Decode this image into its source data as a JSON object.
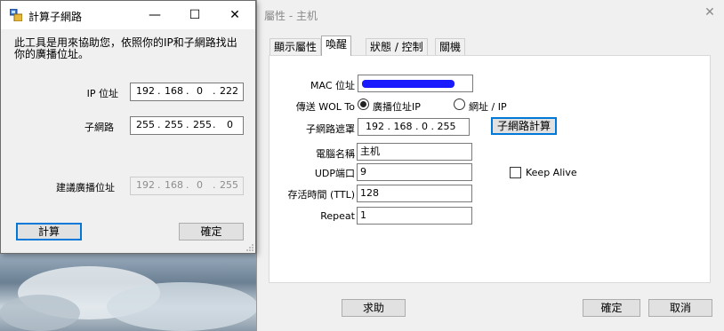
{
  "main_window": {
    "title": "屬性 - 主机",
    "tabs": [
      "顯示屬性",
      "喚醒",
      "狀態 / 控制",
      "關機"
    ],
    "active_tab": "喚醒",
    "form": {
      "mac_label": "MAC 位址",
      "wol_label": "傳送 WOL To",
      "radio_broadcast": "廣播位址IP",
      "radio_url": "網址 / IP",
      "subnet_mask_label": "子網路遮罩",
      "subnet_mask_value": "192 . 168 . 0 . 255",
      "subnet_calc_button": "子網路計算",
      "computer_name_label": "電腦名稱",
      "computer_name_value": "主机",
      "udp_port_label": "UDP端口",
      "udp_port_value": "9",
      "keep_alive_label": "Keep Alive",
      "ttl_label": "存活時間 (TTL)",
      "ttl_value": "128",
      "repeat_label": "Repeat",
      "repeat_value": "1"
    },
    "buttons": {
      "help": "求助",
      "ok": "確定",
      "cancel": "取消"
    }
  },
  "calc_dialog": {
    "title": "計算子網路",
    "description": "此工具是用來協助您，依照你的IP和子網路找出你的廣播位址。",
    "ip_label": "IP 位址",
    "ip_octets": [
      "192",
      "168",
      "0",
      "222"
    ],
    "mask_label": "子網路",
    "mask_octets": [
      "255",
      "255",
      "255",
      "0"
    ],
    "broadcast_label": "建議廣播位址",
    "broadcast_octets": [
      "192",
      "168",
      "0",
      "255"
    ],
    "calc_button": "計算",
    "ok_button": "確定"
  },
  "colors": {
    "focus_blue": "#0078d7",
    "redacted_blue": "#1a1aff"
  }
}
